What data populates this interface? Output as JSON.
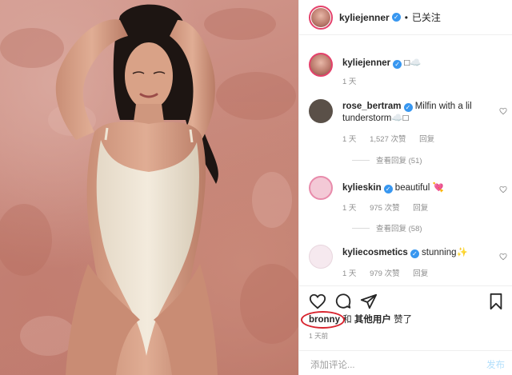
{
  "post": {
    "username": "kyliejenner",
    "follow_status": "已关注",
    "separator": "•",
    "caption_icon": "□☁️",
    "caption_time": "1 天"
  },
  "comments": [
    {
      "username": "rose_bertram",
      "verified": true,
      "text": "Milfin with a lil tunderstorm☁️□",
      "time": "1 天",
      "likes": "1,527 次赞",
      "reply": "回复",
      "view_replies": "查看回复 (51)",
      "avatar_color": "#5a5048"
    },
    {
      "username": "kylieskin",
      "verified": true,
      "text": "beautiful 💘",
      "time": "1 天",
      "likes": "975 次赞",
      "reply": "回复",
      "view_replies": "查看回复 (58)",
      "avatar_color": "#f3c9d6"
    },
    {
      "username": "kyliecosmetics",
      "verified": true,
      "text": "stunning✨",
      "time": "1 天",
      "likes": "979 次赞",
      "reply": "回复",
      "avatar_color": "#f6e9ef"
    }
  ],
  "likes_line": {
    "highlight_user": "bronny",
    "connector": "和",
    "others": "其他用户",
    "suffix": "赞了"
  },
  "post_time": "1 天前",
  "add_comment": {
    "placeholder": "添加评论...",
    "post_button": "发布"
  },
  "icons": [
    "heart-icon",
    "comment-icon",
    "share-icon",
    "bookmark-icon",
    "verified-badge-icon"
  ],
  "colors": {
    "verified": "#3897f0",
    "annotation_circle": "#d8242e",
    "post_button": "#b2dffc"
  }
}
